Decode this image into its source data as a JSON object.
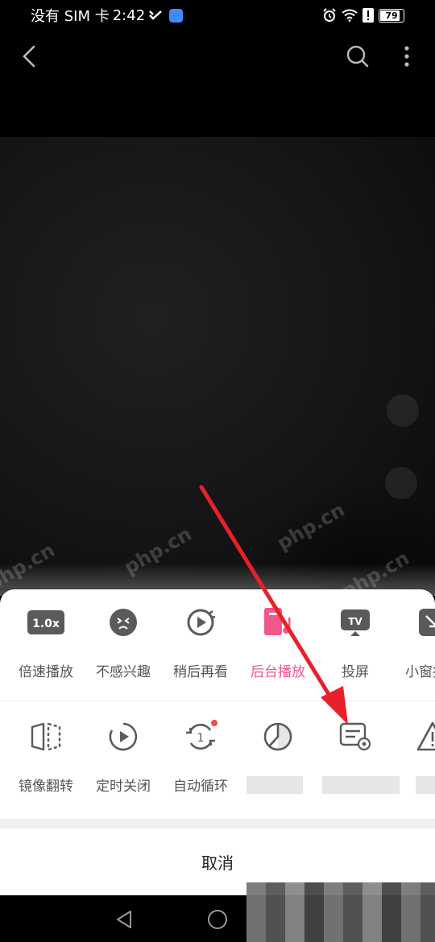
{
  "status_bar": {
    "carrier": "没有 SIM 卡",
    "time": "2:42",
    "battery": "79"
  },
  "video": {
    "watermark": "php.cn"
  },
  "sheet": {
    "row1": [
      {
        "label": "倍速播放",
        "icon": "speed-icon",
        "badge": "1.0x"
      },
      {
        "label": "不感兴趣",
        "icon": "not-interested-icon"
      },
      {
        "label": "稍后再看",
        "icon": "watch-later-icon"
      },
      {
        "label": "后台播放",
        "icon": "background-play-icon",
        "active": true
      },
      {
        "label": "投屏",
        "icon": "cast-icon",
        "badge": "TV"
      },
      {
        "label": "小窗播放",
        "icon": "mini-window-icon"
      }
    ],
    "row2": [
      {
        "label": "镜像翻转",
        "icon": "mirror-flip-icon"
      },
      {
        "label": "定时关闭",
        "icon": "timer-off-icon"
      },
      {
        "label": "自动循环",
        "icon": "auto-loop-icon",
        "badge": "1"
      },
      {
        "label": "",
        "icon": "pie-chart-icon"
      },
      {
        "label": "",
        "icon": "settings-list-icon"
      },
      {
        "label": "",
        "icon": "report-icon"
      }
    ],
    "cancel": "取消"
  },
  "colors": {
    "accent": "#f0588c",
    "arrow": "#e8202a"
  }
}
